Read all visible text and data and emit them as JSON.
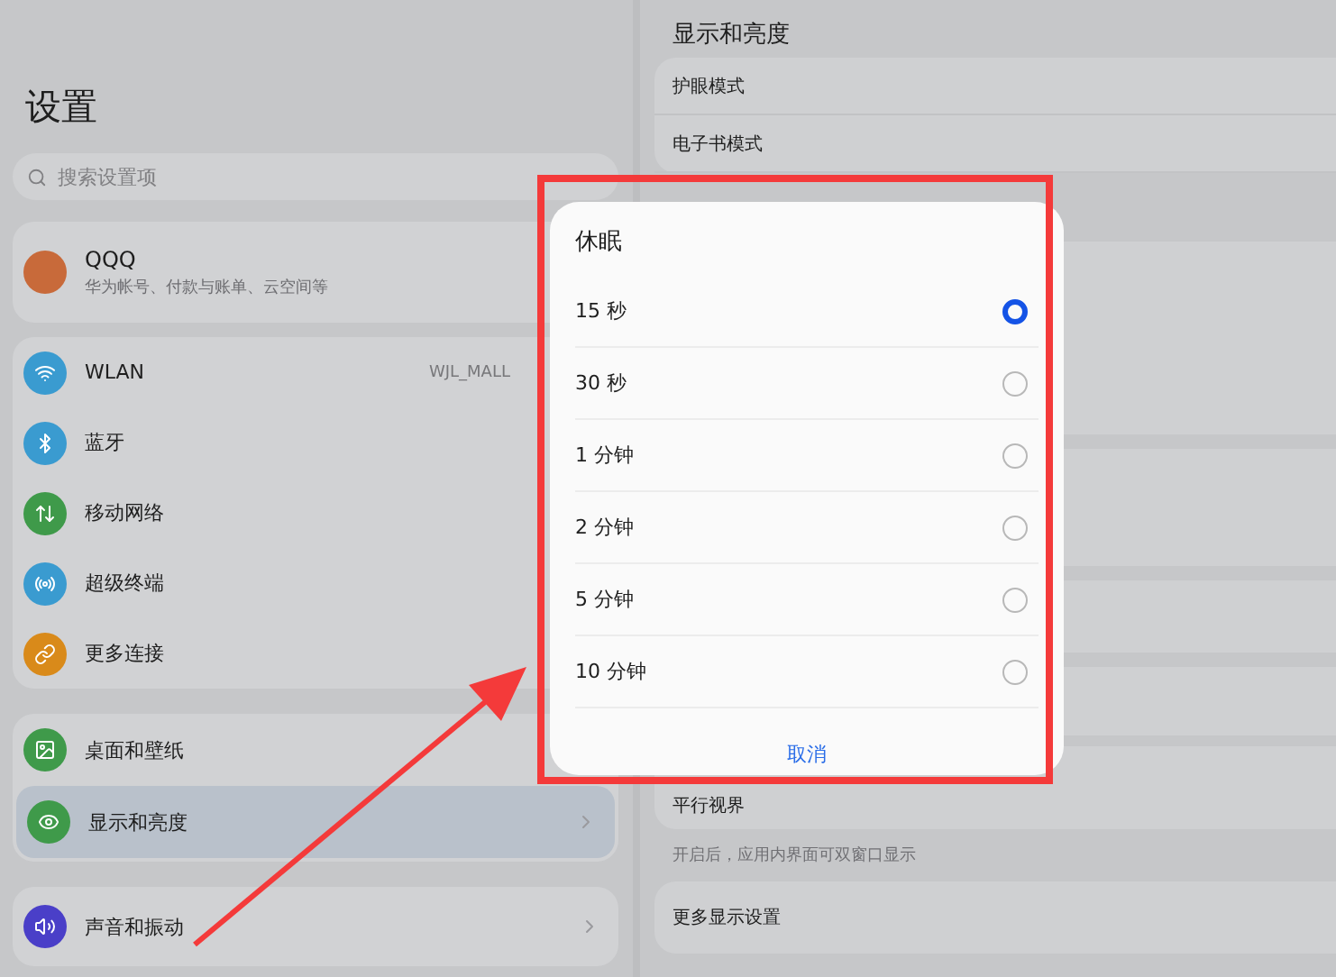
{
  "sidebar": {
    "title": "设置",
    "search": {
      "placeholder": "搜索设置项"
    },
    "account": {
      "name": "QQQ",
      "subtitle": "华为帐号、付款与账单、云空间等"
    },
    "groups": [
      {
        "items": [
          {
            "label": "WLAN",
            "value": "WJL_MALL",
            "color": "#3a9bd0",
            "selected": false,
            "chevron": false
          },
          {
            "label": "蓝牙",
            "color": "#3a9bd0",
            "selected": false,
            "chevron": false
          },
          {
            "label": "移动网络",
            "color": "#3f9a4a",
            "selected": false,
            "chevron": false
          },
          {
            "label": "超级终端",
            "color": "#3a9bd0",
            "selected": false,
            "chevron": false
          },
          {
            "label": "更多连接",
            "color": "#d98a1a",
            "selected": false,
            "chevron": false
          }
        ]
      },
      {
        "items": [
          {
            "label": "桌面和壁纸",
            "color": "#3f9a4a",
            "selected": false,
            "chevron": false
          },
          {
            "label": "显示和亮度",
            "color": "#3f9a4a",
            "selected": true,
            "chevron": true
          }
        ]
      },
      {
        "items": [
          {
            "label": "声音和振动",
            "color": "#4a3fc8",
            "selected": false,
            "chevron": true
          }
        ]
      }
    ]
  },
  "detail": {
    "title": "显示和亮度",
    "rows": [
      "护眼模式",
      "电子书模式"
    ],
    "parallel": {
      "label": "平行视界",
      "hint": "开启后，应用内界面可双窗口显示"
    },
    "more": "更多显示设置"
  },
  "dialog": {
    "title": "休眠",
    "options": [
      {
        "label": "15 秒",
        "selected": true
      },
      {
        "label": "30 秒",
        "selected": false
      },
      {
        "label": "1 分钟",
        "selected": false
      },
      {
        "label": "2 分钟",
        "selected": false
      },
      {
        "label": "5 分钟",
        "selected": false
      },
      {
        "label": "10 分钟",
        "selected": false
      }
    ],
    "cancel": "取消"
  }
}
